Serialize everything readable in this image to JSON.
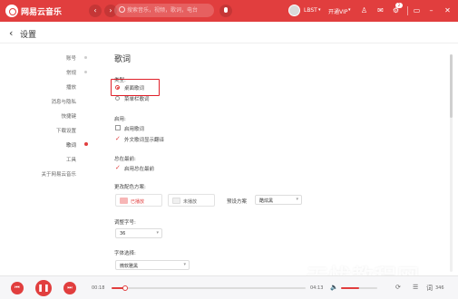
{
  "app": {
    "title": "网易云音乐",
    "brand_color": "#e13e3e"
  },
  "topbar": {
    "nav_back": "‹",
    "nav_forward": "›",
    "search_placeholder": "搜索音乐，视频，歌词，电台",
    "username": "LBST",
    "caret": "▾",
    "vip_label": "开通VIP",
    "message_badge": "2",
    "icons": [
      "mic-icon",
      "tshirt-icon",
      "mail-icon",
      "gear-icon",
      "mini-mode-icon",
      "minimize-icon",
      "close-icon"
    ],
    "shirt_glyph": "♙",
    "mail_glyph": "✉",
    "gear_glyph": "⚙",
    "mini_glyph": "▭",
    "min_glyph": "–",
    "close_glyph": "✕"
  },
  "header": {
    "back": "‹",
    "title": "设置"
  },
  "settings_nav": {
    "items": [
      "账号",
      "常规",
      "播放",
      "消息与隐私",
      "快捷键",
      "下载设置",
      "歌词",
      "工具",
      "关于网易云音乐"
    ],
    "active": "歌词"
  },
  "lyrics": {
    "section_title": "歌词",
    "type_label": "类型:",
    "type_options": [
      {
        "label": "桌面歌词",
        "selected": true
      },
      {
        "label": "菜单栏歌词",
        "selected": false
      }
    ],
    "enable_label": "启用:",
    "enable_options": [
      {
        "label": "启用歌词",
        "checked": false
      },
      {
        "label": "外文歌词显示翻译",
        "checked": true
      }
    ],
    "topmost_label": "总在最前:",
    "topmost_options": [
      {
        "label": "启用总在最前",
        "checked": true
      }
    ],
    "check_glyph": "✓",
    "scheme_label": "更改配色方案:",
    "played_label": "已播放",
    "unplayed_label": "未播放",
    "played_color": "#f7b6b6",
    "unplayed_color": "#f0f0f0",
    "preset_label": "预设方案",
    "preset_value": "酷炫黑",
    "size_label": "调整字号:",
    "size_value": "36",
    "font_label": "字体选择:",
    "font_value": "微软雅黑",
    "dropdown_arrow": "▾"
  },
  "player": {
    "prev": "⏮",
    "play": "❚❚",
    "next": "⏭",
    "current_time": "00:18",
    "total_time": "04:13",
    "progress": 0.07,
    "volume": 0.5,
    "volume_glyph": "🔈",
    "mode_glyph": "⟳",
    "list_glyph": "☰",
    "lyric_glyph": "词",
    "playlist_count": "346"
  },
  "watermark": "无忧教程网"
}
